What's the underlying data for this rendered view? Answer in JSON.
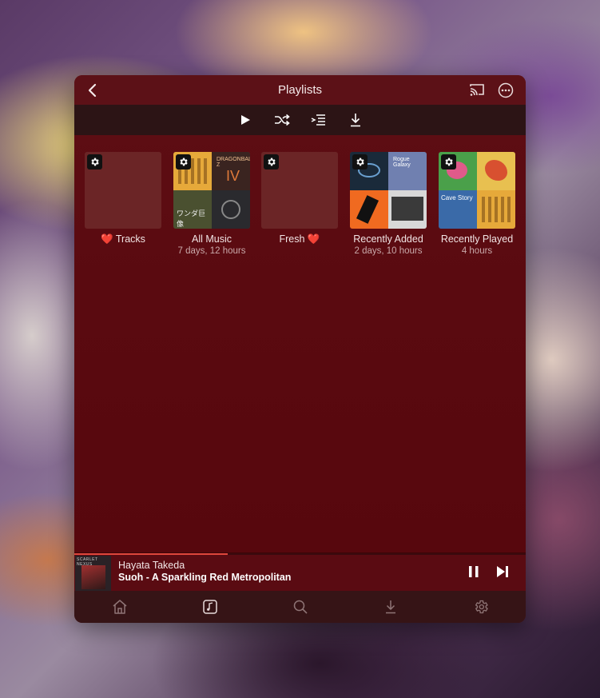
{
  "header": {
    "title": "Playlists",
    "back_icon": "chevron-left-icon",
    "cast_icon": "airplay-icon",
    "more_icon": "ellipsis-circle-icon"
  },
  "toolbar": {
    "buttons": [
      {
        "name": "play-all-button",
        "icon": "play-icon"
      },
      {
        "name": "shuffle-button",
        "icon": "shuffle-icon"
      },
      {
        "name": "add-to-queue-button",
        "icon": "queue-add-icon"
      },
      {
        "name": "download-button",
        "icon": "download-icon"
      }
    ]
  },
  "playlists": [
    {
      "title": "❤️ Tracks",
      "subtitle": "",
      "has_art": false
    },
    {
      "title": "All Music",
      "subtitle": "7 days, 12 hours",
      "has_art": true
    },
    {
      "title": "Fresh ❤️",
      "subtitle": "",
      "has_art": false
    },
    {
      "title": "Recently Added",
      "subtitle": "2 days, 10 hours",
      "has_art": true
    },
    {
      "title": "Recently Played",
      "subtitle": "4 hours",
      "has_art": true
    }
  ],
  "now_playing": {
    "artist": "Hayata Takeda",
    "title": "Suoh - A Sparkling Red Metropolitan",
    "progress": 0.34,
    "art_label": "SCARLET NEXUS"
  },
  "tabs": [
    {
      "name": "tab-home",
      "icon": "home-icon"
    },
    {
      "name": "tab-library",
      "icon": "music-note-icon",
      "active": true
    },
    {
      "name": "tab-search",
      "icon": "search-icon"
    },
    {
      "name": "tab-downloads",
      "icon": "download-icon"
    },
    {
      "name": "tab-settings",
      "icon": "gear-icon"
    }
  ],
  "colors": {
    "accent": "#e0463c",
    "panel": "#5a0a10",
    "tabbar": "#361416"
  }
}
